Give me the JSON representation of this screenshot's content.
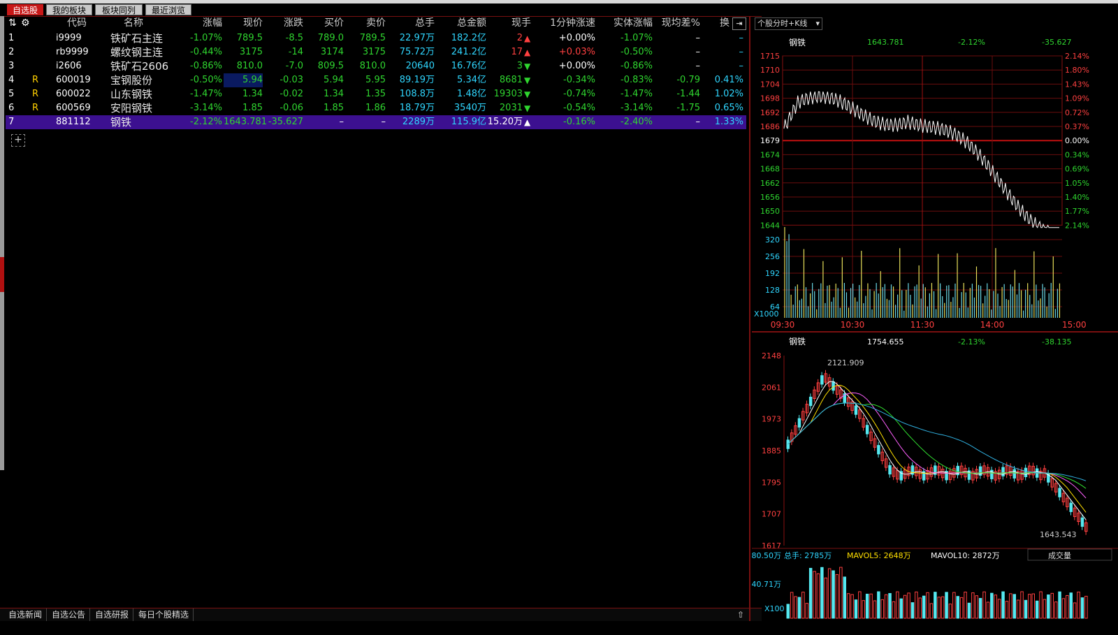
{
  "top_tabs": [
    "自选股",
    "我的板块",
    "板块同列",
    "最近浏览"
  ],
  "columns": [
    "代码",
    "名称",
    "涨幅",
    "现价",
    "涨跌",
    "买价",
    "卖价",
    "总手",
    "总金额",
    "现手",
    "1分钟涨速",
    "实体涨幅",
    "现均差%",
    "换"
  ],
  "rows": [
    {
      "idx": "1",
      "flag": "",
      "code": "i9999",
      "name": "铁矿石主连",
      "chg_pct": "-1.07%",
      "price": "789.5",
      "chg": "-8.5",
      "bid": "789.0",
      "ask": "789.5",
      "vol": "22.97万",
      "amount": "182.2亿",
      "cur": "2",
      "cur_dir": "up",
      "speed": "+0.00%",
      "body": "-1.07%",
      "avgdiff": "–",
      "turn": "–"
    },
    {
      "idx": "2",
      "flag": "",
      "code": "rb9999",
      "name": "螺纹钢主连",
      "chg_pct": "-0.44%",
      "price": "3175",
      "chg": "-14",
      "bid": "3174",
      "ask": "3175",
      "vol": "75.72万",
      "amount": "241.2亿",
      "cur": "17",
      "cur_dir": "up",
      "speed": "+0.03%",
      "body": "-0.50%",
      "avgdiff": "–",
      "turn": "–"
    },
    {
      "idx": "3",
      "flag": "",
      "code": "i2606",
      "name": "铁矿石2606",
      "chg_pct": "-0.86%",
      "price": "810.0",
      "chg": "-7.0",
      "bid": "809.5",
      "ask": "810.0",
      "vol": "20640",
      "amount": "16.76亿",
      "cur": "3",
      "cur_dir": "down",
      "speed": "+0.00%",
      "body": "-0.86%",
      "avgdiff": "–",
      "turn": "–"
    },
    {
      "idx": "4",
      "flag": "R",
      "code": "600019",
      "name": "宝钢股份",
      "chg_pct": "-0.50%",
      "price": "5.94",
      "chg": "-0.03",
      "bid": "5.94",
      "ask": "5.95",
      "vol": "89.19万",
      "amount": "5.34亿",
      "cur": "8681",
      "cur_dir": "down",
      "speed": "-0.34%",
      "body": "-0.83%",
      "avgdiff": "-0.79",
      "turn": "0.41%"
    },
    {
      "idx": "5",
      "flag": "R",
      "code": "600022",
      "name": "山东钢铁",
      "chg_pct": "-1.47%",
      "price": "1.34",
      "chg": "-0.02",
      "bid": "1.34",
      "ask": "1.35",
      "vol": "108.8万",
      "amount": "1.48亿",
      "cur": "19303",
      "cur_dir": "down",
      "speed": "-0.74%",
      "body": "-1.47%",
      "avgdiff": "-1.44",
      "turn": "1.02%"
    },
    {
      "idx": "6",
      "flag": "R",
      "code": "600569",
      "name": "安阳钢铁",
      "chg_pct": "-3.14%",
      "price": "1.85",
      "chg": "-0.06",
      "bid": "1.85",
      "ask": "1.86",
      "vol": "18.79万",
      "amount": "3540万",
      "cur": "2031",
      "cur_dir": "down",
      "speed": "-0.54%",
      "body": "-3.14%",
      "avgdiff": "-1.75",
      "turn": "0.65%"
    },
    {
      "idx": "7",
      "flag": "",
      "code": "881112",
      "name": "钢铁",
      "chg_pct": "-2.12%",
      "price": "1643.781",
      "chg": "-35.627",
      "bid": "–",
      "ask": "–",
      "vol": "2289万",
      "amount": "115.9亿",
      "cur": "15.20万",
      "cur_dir": "up",
      "speed": "-0.16%",
      "body": "-2.40%",
      "avgdiff": "–",
      "turn": "1.33%"
    }
  ],
  "bottom_tabs": [
    "自选新闻",
    "自选公告",
    "自选研报",
    "每日个股精选"
  ],
  "intraday": {
    "dropdown": "个股分时+K线",
    "name": "钢铁",
    "price": "1643.781",
    "pct": "-2.12%",
    "chg": "-35.627",
    "y_left": [
      "1715",
      "1710",
      "1704",
      "1698",
      "1692",
      "1686",
      "1679",
      "1674",
      "1668",
      "1662",
      "1656",
      "1650",
      "1644"
    ],
    "y_right": [
      "2.14%",
      "1.80%",
      "1.43%",
      "1.09%",
      "0.72%",
      "0.37%",
      "0.00%",
      "0.34%",
      "0.69%",
      "1.05%",
      "1.40%",
      "1.77%",
      "2.14%"
    ],
    "vol_ticks": [
      "320",
      "256",
      "192",
      "128",
      "64"
    ],
    "vol_unit": "X1000",
    "x_ticks": [
      "09:30",
      "10:30",
      "11:30",
      "14:00",
      "15:00"
    ]
  },
  "kline": {
    "name": "钢铁",
    "price": "1754.655",
    "pct": "-2.13%",
    "chg": "-38.135",
    "y_ticks": [
      "2148",
      "2061",
      "1973",
      "1885",
      "1795",
      "1707",
      "1617"
    ],
    "high_label": "2121.909",
    "low_label": "1643.543",
    "vol_header": {
      "total": "总手: 2785万",
      "mavol5": "MAVOL5: 2648万",
      "mavol10": "MAVOL10: 2872万"
    },
    "vol_ticks": [
      "80.50万",
      "40.71万"
    ],
    "vol_unit": "X100",
    "vol_select": "成交量"
  },
  "colors": {
    "up": "#ff4040",
    "down": "#2fd62f",
    "accent": "#c81818",
    "select": "#3c1090"
  }
}
